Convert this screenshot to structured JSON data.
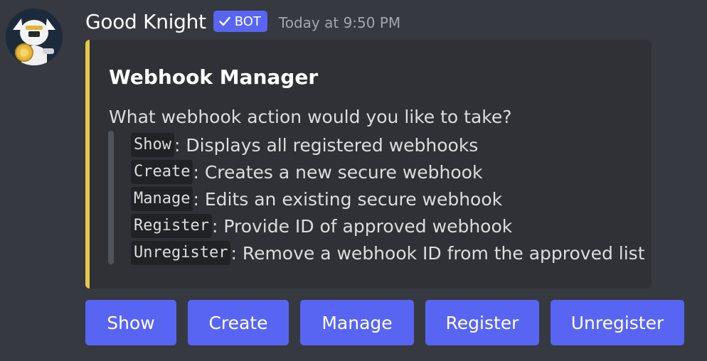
{
  "message": {
    "author": "Good Knight",
    "bot_tag": "BOT",
    "timestamp": "Today at 9:50 PM"
  },
  "embed": {
    "title": "Webhook Manager",
    "description": "What webhook action would you like to take?",
    "accent_color": "#e6c94a",
    "actions": [
      {
        "code": "Show",
        "text": ": Displays all registered webhooks"
      },
      {
        "code": "Create",
        "text": ": Creates a new secure webhook"
      },
      {
        "code": "Manage",
        "text": ": Edits an existing secure webhook"
      },
      {
        "code": "Register",
        "text": ": Provide ID of approved webhook"
      },
      {
        "code": "Unregister",
        "text": ": Remove a webhook ID from the approved list"
      }
    ]
  },
  "buttons": [
    {
      "label": "Show"
    },
    {
      "label": "Create"
    },
    {
      "label": "Manage"
    },
    {
      "label": "Register"
    },
    {
      "label": "Unregister"
    }
  ],
  "colors": {
    "background": "#36393f",
    "embed_background": "#2f3136",
    "button": "#5865f2",
    "code_background": "#202225"
  },
  "icons": {
    "avatar": "knight-avatar-icon",
    "verified": "checkmark-icon"
  }
}
